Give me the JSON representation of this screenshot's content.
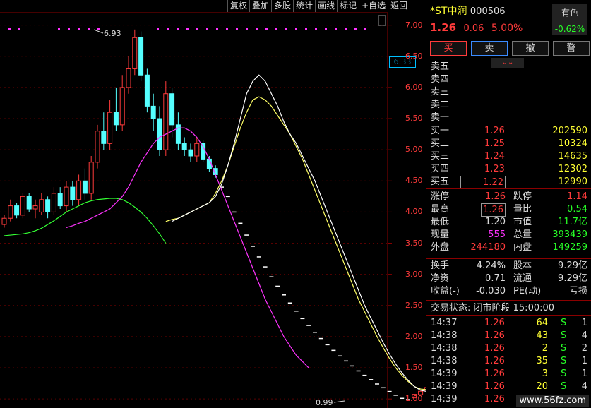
{
  "toolbar": [
    "复权",
    "叠加",
    "多股",
    "统计",
    "画线",
    "标记",
    "+自选",
    "返回"
  ],
  "symbol": {
    "name": "*ST中润",
    "code": "000506",
    "price": "1.26",
    "change": "0.06",
    "change_pct": "5.00%"
  },
  "sector": {
    "name": "有色",
    "pct": "-0.62%"
  },
  "actions": {
    "buy": "买",
    "sell": "卖",
    "cancel": "撤",
    "alert": "警"
  },
  "sell_orders": [
    {
      "label": "卖五",
      "price": "",
      "vol": ""
    },
    {
      "label": "卖四",
      "price": "",
      "vol": ""
    },
    {
      "label": "卖三",
      "price": "",
      "vol": ""
    },
    {
      "label": "卖二",
      "price": "",
      "vol": ""
    },
    {
      "label": "卖一",
      "price": "",
      "vol": ""
    }
  ],
  "buy_orders": [
    {
      "label": "买一",
      "price": "1.26",
      "vol": "202590"
    },
    {
      "label": "买二",
      "price": "1.25",
      "vol": "10324"
    },
    {
      "label": "买三",
      "price": "1.24",
      "vol": "14635"
    },
    {
      "label": "买四",
      "price": "1.23",
      "vol": "12302"
    },
    {
      "label": "买五",
      "price": "1.22",
      "vol": "12990"
    }
  ],
  "stats": [
    {
      "l1": "涨停",
      "v1": "1.26",
      "l2": "跌停",
      "v2": "1.14"
    },
    {
      "l1": "最高",
      "v1": "1.26",
      "l2": "量比",
      "v2": "0.54"
    },
    {
      "l1": "最低",
      "v1": "1.20",
      "l2": "市值",
      "v2": "11.7亿"
    },
    {
      "l1": "现量",
      "v1": "555",
      "l2": "总量",
      "v2": "393439"
    },
    {
      "l1": "外盘",
      "v1": "244180",
      "l2": "内盘",
      "v2": "149259"
    }
  ],
  "stats2": [
    {
      "l1": "换手",
      "v1": "4.24%",
      "l2": "股本",
      "v2": "9.29亿"
    },
    {
      "l1": "净资",
      "v1": "0.71",
      "l2": "流通",
      "v2": "9.29亿"
    },
    {
      "l1": "收益(-)",
      "v1": "-0.030",
      "l2": "PE(动)",
      "v2": "亏损"
    }
  ],
  "trade_status": "交易状态: 闭市阶段 15:00:00",
  "ticks": [
    {
      "time": "14:37",
      "price": "1.26",
      "vol": "64",
      "side": "S",
      "n": "1"
    },
    {
      "time": "14:38",
      "price": "1.26",
      "vol": "43",
      "side": "S",
      "n": "4"
    },
    {
      "time": "14:38",
      "price": "1.26",
      "vol": "2",
      "side": "S",
      "n": "2"
    },
    {
      "time": "14:38",
      "price": "1.26",
      "vol": "35",
      "side": "S",
      "n": "1"
    },
    {
      "time": "14:39",
      "price": "1.26",
      "vol": "3",
      "side": "S",
      "n": "1"
    },
    {
      "time": "14:39",
      "price": "1.26",
      "vol": "20",
      "side": "S",
      "n": "4"
    },
    {
      "time": "14:39",
      "price": "1.26",
      "vol": "",
      "side": "",
      "n": ""
    }
  ],
  "chart": {
    "y_labels": [
      "7.00",
      "6.50",
      "6.00",
      "5.50",
      "5.00",
      "4.50",
      "4.00",
      "3.50",
      "3.00",
      "2.50",
      "2.00",
      "1.50",
      "1.00"
    ],
    "current_price_label": "6.33",
    "high_label": "6.93",
    "low_label": "0.99",
    "colors": {
      "up": "#ff3b3b",
      "down": "#55ffff",
      "ma5": "#ffffff",
      "ma10": "#ffff66",
      "ma20": "#ff33ff",
      "ma60": "#33ff33"
    }
  },
  "chart_data": {
    "type": "candlestick",
    "ylim": [
      0.9,
      7.2
    ],
    "candles": [
      [
        3.8,
        3.9,
        3.75,
        3.95
      ],
      [
        3.9,
        4.1,
        3.85,
        4.2
      ],
      [
        4.1,
        3.95,
        3.9,
        4.15
      ],
      [
        3.95,
        4.25,
        3.9,
        4.3
      ],
      [
        4.25,
        4.05,
        4.0,
        4.3
      ],
      [
        4.05,
        4.1,
        3.9,
        4.2
      ],
      [
        4.0,
        4.2,
        3.95,
        4.3
      ],
      [
        4.2,
        4.0,
        3.9,
        4.25
      ],
      [
        4.0,
        4.3,
        3.95,
        4.4
      ],
      [
        4.3,
        4.1,
        4.05,
        4.4
      ],
      [
        4.1,
        4.4,
        4.0,
        4.5
      ],
      [
        4.4,
        4.2,
        4.1,
        4.5
      ],
      [
        4.2,
        4.5,
        4.1,
        4.6
      ],
      [
        4.5,
        4.3,
        4.2,
        4.7
      ],
      [
        4.3,
        4.8,
        4.2,
        4.9
      ],
      [
        4.8,
        5.3,
        4.7,
        5.4
      ],
      [
        5.3,
        5.1,
        5.0,
        5.6
      ],
      [
        5.1,
        5.6,
        5.0,
        5.8
      ],
      [
        5.6,
        5.4,
        5.3,
        6.0
      ],
      [
        5.4,
        6.0,
        5.3,
        6.2
      ],
      [
        6.0,
        6.3,
        5.9,
        6.5
      ],
      [
        6.3,
        6.8,
        6.2,
        6.93
      ],
      [
        6.8,
        6.2,
        6.1,
        6.9
      ],
      [
        6.2,
        5.7,
        5.6,
        6.3
      ],
      [
        5.7,
        5.5,
        5.3,
        5.9
      ],
      [
        5.5,
        5.0,
        4.9,
        5.7
      ],
      [
        5.0,
        5.9,
        4.9,
        6.1
      ],
      [
        5.9,
        5.4,
        5.2,
        6.0
      ],
      [
        5.4,
        5.1,
        5.0,
        5.6
      ],
      [
        5.1,
        5.0,
        4.9,
        5.2
      ],
      [
        5.0,
        4.9,
        4.8,
        5.1
      ],
      [
        4.9,
        5.1,
        4.8,
        5.2
      ],
      [
        5.1,
        4.85,
        4.8,
        5.15
      ],
      [
        4.85,
        4.7,
        4.65,
        4.9
      ],
      [
        4.7,
        4.6,
        4.55,
        4.75
      ]
    ],
    "limit_down_path": [
      4.4,
      4.25,
      4.0,
      3.82,
      3.63,
      3.45,
      3.28,
      3.12,
      2.96,
      2.81,
      2.67,
      2.54,
      2.41,
      2.29,
      2.18,
      2.07,
      1.97,
      1.87,
      1.78,
      1.69,
      1.61,
      1.53,
      1.45,
      1.38,
      1.31,
      1.24,
      1.18,
      1.12,
      1.06,
      1.01,
      0.99,
      1.04,
      1.09,
      1.15,
      1.2,
      1.26
    ],
    "ma5": [
      3.85,
      3.9,
      3.95,
      4.0,
      4.05,
      4.1,
      4.15,
      4.25,
      4.45,
      4.75,
      5.1,
      5.5,
      5.9,
      6.1,
      6.2,
      6.1,
      5.9,
      5.7,
      5.45,
      5.25,
      5.1,
      4.9,
      4.7,
      4.5,
      4.25,
      4.0,
      3.75,
      3.5,
      3.25,
      3.0,
      2.75,
      2.5,
      2.3,
      2.1,
      1.9,
      1.72,
      1.56,
      1.42,
      1.3,
      1.2,
      1.14,
      1.12,
      1.14,
      1.2
    ],
    "ma10": [
      3.85,
      3.88,
      3.9,
      3.95,
      4.0,
      4.05,
      4.1,
      4.15,
      4.3,
      4.5,
      4.75,
      5.05,
      5.35,
      5.6,
      5.8,
      5.85,
      5.8,
      5.7,
      5.55,
      5.4,
      5.25,
      5.05,
      4.85,
      4.6,
      4.35,
      4.1,
      3.85,
      3.6,
      3.35,
      3.1,
      2.85,
      2.6,
      2.4,
      2.2,
      2.0,
      1.82,
      1.65,
      1.5,
      1.38,
      1.28,
      1.2,
      1.16,
      1.15,
      1.18
    ],
    "ma20": [
      3.75,
      3.78,
      3.82,
      3.85,
      3.9,
      3.95,
      4.0,
      4.05,
      4.15,
      4.25,
      4.4,
      4.6,
      4.8,
      4.95,
      5.1,
      5.2,
      5.25,
      5.3,
      5.35,
      5.35,
      5.3,
      5.2,
      5.05,
      4.85,
      4.6,
      4.35,
      4.1,
      3.85,
      3.6,
      3.35,
      3.1,
      2.85,
      2.6,
      2.4,
      2.2,
      2.0,
      1.85,
      1.7,
      1.6,
      1.5
    ],
    "ma60": [
      3.62,
      3.63,
      3.64,
      3.65,
      3.67,
      3.7,
      3.74,
      3.8,
      3.86,
      3.93,
      4.0,
      4.05,
      4.1,
      4.15,
      4.18,
      4.2,
      4.21,
      4.22,
      4.22,
      4.2,
      4.15,
      4.08,
      4.0,
      3.9,
      3.78,
      3.65,
      3.5
    ]
  }
}
